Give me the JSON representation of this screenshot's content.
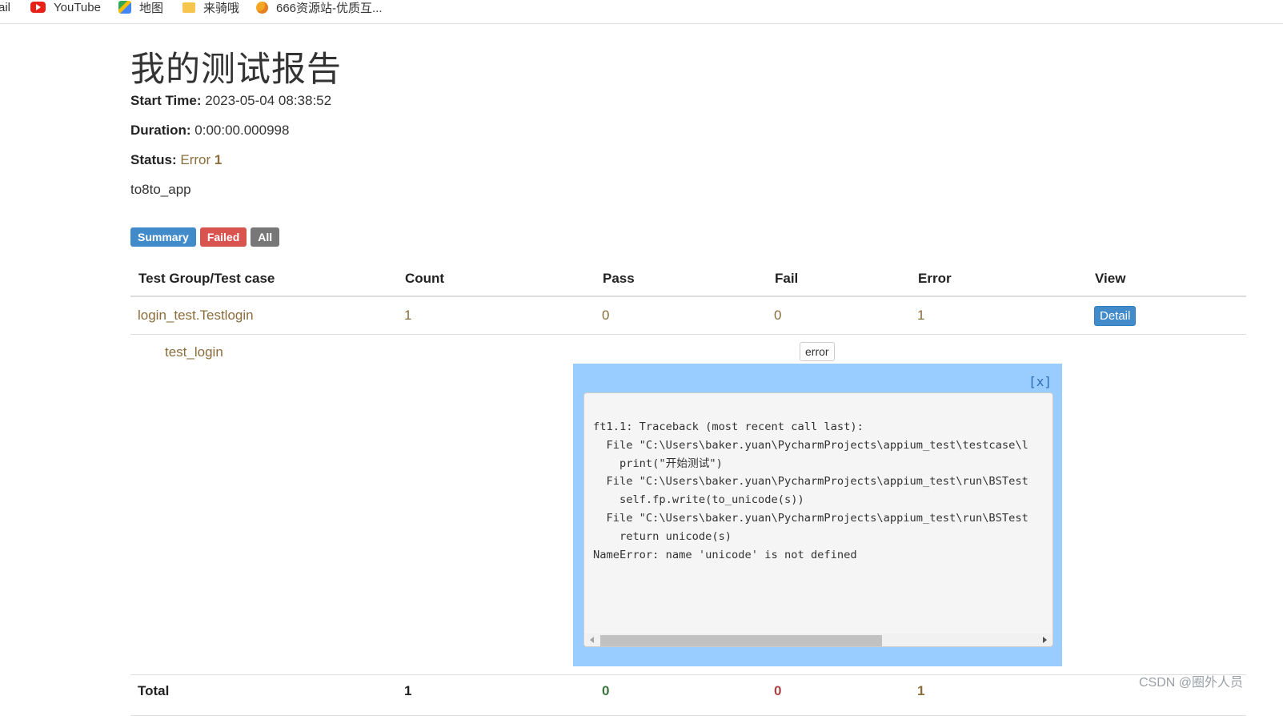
{
  "bookmarks": [
    {
      "label": "ail",
      "icon": "none"
    },
    {
      "label": "YouTube",
      "icon": "youtube-icon"
    },
    {
      "label": "地图",
      "icon": "maps-icon"
    },
    {
      "label": "来骑哦",
      "icon": "folder-icon"
    },
    {
      "label": "666资源站-优质互...",
      "icon": "site-icon"
    }
  ],
  "report": {
    "title": "我的测试报告",
    "start_time_label": "Start Time:",
    "start_time": "2023-05-04 08:38:52",
    "duration_label": "Duration:",
    "duration": "0:00:00.000998",
    "status_label": "Status:",
    "status_text": "Error",
    "status_count": "1",
    "description": "to8to_app"
  },
  "filters": {
    "summary": "Summary",
    "failed": "Failed",
    "all": "All"
  },
  "table": {
    "headers": [
      "Test Group/Test case",
      "Count",
      "Pass",
      "Fail",
      "Error",
      "View"
    ],
    "group_row": {
      "name": "login_test.Testlogin",
      "count": "1",
      "pass": "0",
      "fail": "0",
      "error": "1",
      "view": "Detail"
    },
    "case_row": {
      "name": "test_login",
      "status": "error"
    },
    "total_row": {
      "name": "Total",
      "count": "1",
      "pass": "0",
      "fail": "0",
      "error": "1"
    }
  },
  "popup": {
    "close": "[x]",
    "traceback": "ft1.1: Traceback (most recent call last):\n  File \"C:\\Users\\baker.yuan\\PycharmProjects\\appium_test\\testcase\\l\n    print(\"开始测试\")\n  File \"C:\\Users\\baker.yuan\\PycharmProjects\\appium_test\\run\\BSTest\n    self.fp.write(to_unicode(s))\n  File \"C:\\Users\\baker.yuan\\PycharmProjects\\appium_test\\run\\BSTest\n    return unicode(s)\nNameError: name 'unicode' is not defined"
  },
  "watermark": "CSDN @圈外人员",
  "colors": {
    "primary": "#428bca",
    "danger": "#d9534f",
    "muted": "#777777",
    "warning_text": "#8a6d3b",
    "popup_bg": "#99ccff"
  }
}
